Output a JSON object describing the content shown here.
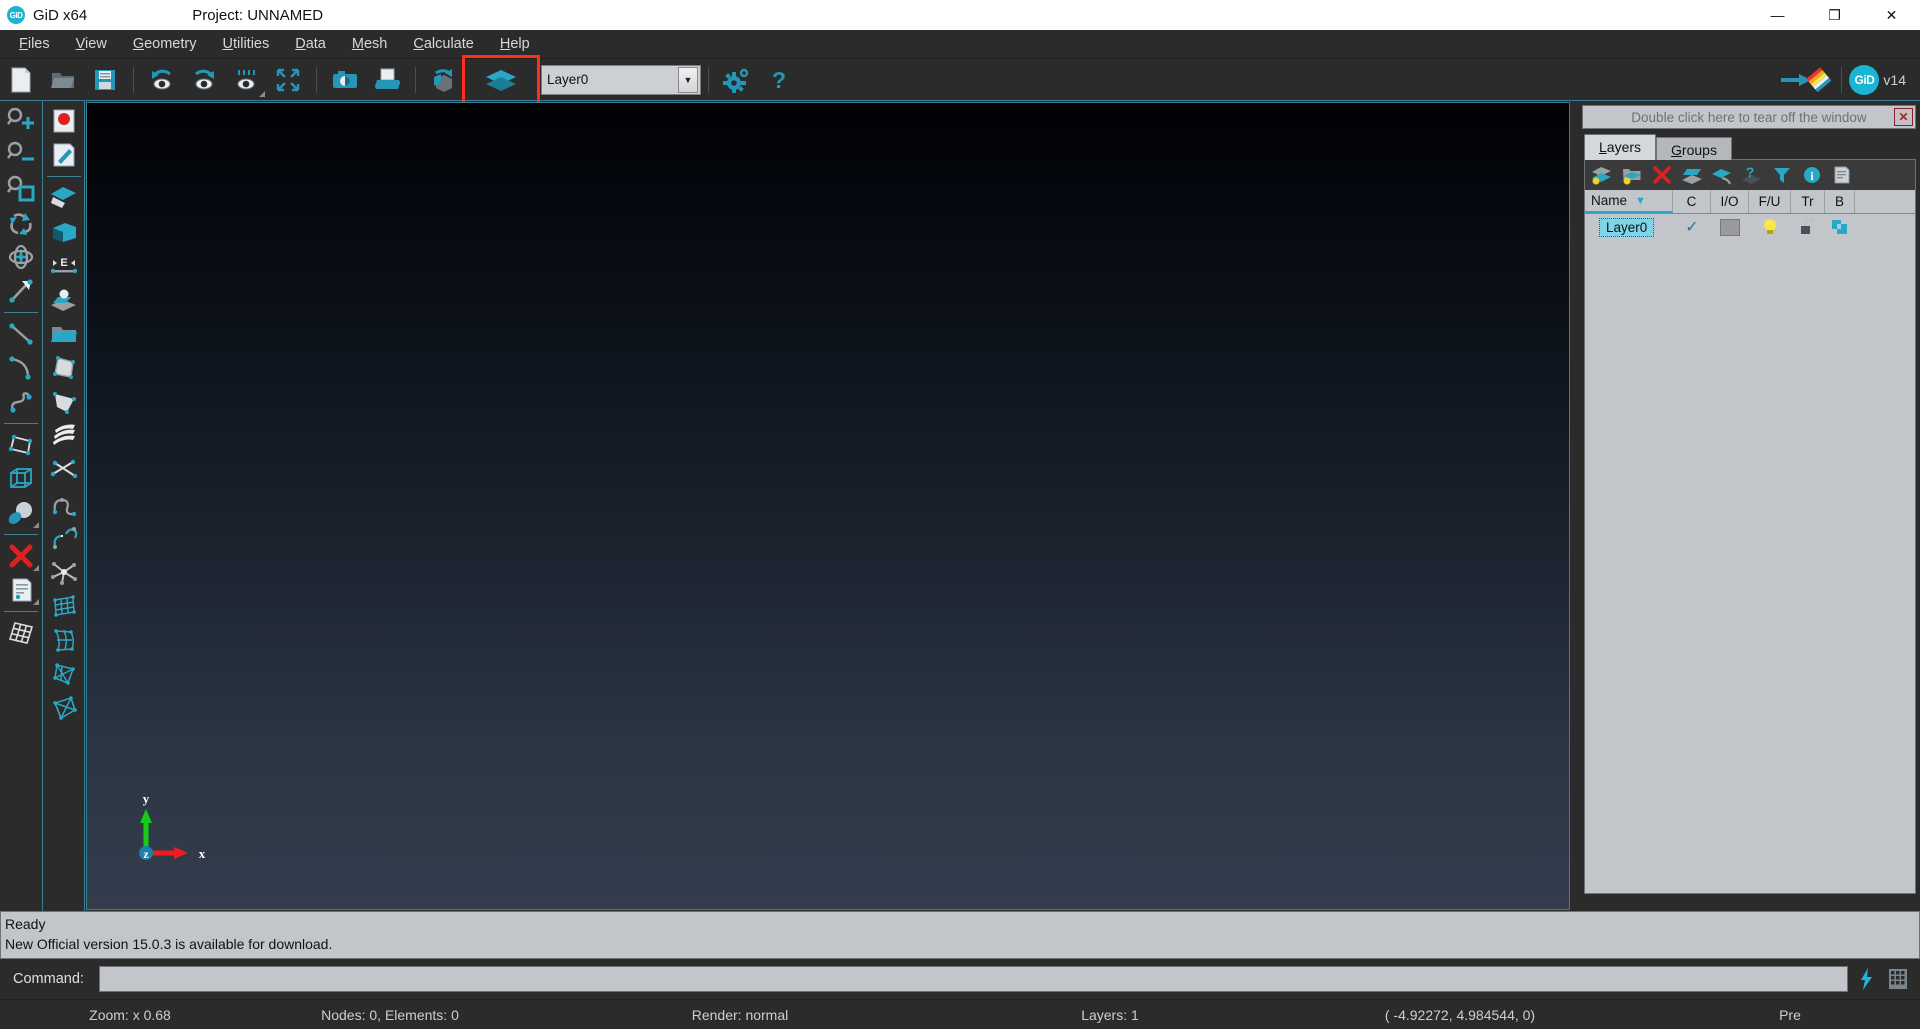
{
  "titlebar": {
    "logo_text": "GiD",
    "app_title": "GiD x64",
    "project_label": "Project: UNNAMED",
    "minimize_glyph": "—",
    "maximize_glyph": "❐",
    "close_glyph": "✕"
  },
  "menubar": {
    "items": [
      {
        "label": "Files",
        "accel": "F"
      },
      {
        "label": "View",
        "accel": "V"
      },
      {
        "label": "Geometry",
        "accel": "G"
      },
      {
        "label": "Utilities",
        "accel": "U"
      },
      {
        "label": "Data",
        "accel": "D"
      },
      {
        "label": "Mesh",
        "accel": "M"
      },
      {
        "label": "Calculate",
        "accel": "C"
      },
      {
        "label": "Help",
        "accel": "H"
      }
    ]
  },
  "toolbar": {
    "buttons": [
      {
        "name": "new-file-icon",
        "tip": "New"
      },
      {
        "name": "open-folder-icon",
        "tip": "Open"
      },
      {
        "name": "save-floppy-icon",
        "tip": "Save"
      },
      {
        "name": "undo-view-eye-icon",
        "tip": "Previous view"
      },
      {
        "name": "redo-view-eye-icon",
        "tip": "Next view"
      },
      {
        "name": "view-options-eye-icon",
        "tip": "View options"
      },
      {
        "name": "zoom-frame-icon",
        "tip": "Zoom frame"
      },
      {
        "name": "camera-icon",
        "tip": "Render image"
      },
      {
        "name": "print-icon",
        "tip": "Print"
      },
      {
        "name": "rotate-cube-icon",
        "tip": "Rotate"
      },
      {
        "name": "layers-icon",
        "tip": "Layers"
      }
    ],
    "layer_combo": {
      "value": "Layer0",
      "placeholder": "Layer0",
      "arrow_glyph": "▼"
    },
    "gear_icon": "preferences-gear-icon",
    "help_icon": "help-question-icon",
    "results_icon": "arrow-rainbow-icon",
    "gid_logo_text": "GiD",
    "version_label": "v14",
    "highlight_color": "#ff2d1a"
  },
  "left_toolbar": {
    "column_one": [
      {
        "name": "zoom-in-icon"
      },
      {
        "name": "zoom-out-icon"
      },
      {
        "name": "zoom-frame-icon"
      },
      {
        "name": "rotate-trackball-icon"
      },
      {
        "name": "pan-move-icon"
      },
      {
        "name": "normal-vector-icon"
      },
      {
        "separator": true
      },
      {
        "name": "create-line-icon"
      },
      {
        "name": "create-arc-icon"
      },
      {
        "name": "create-nurbs-line-icon"
      },
      {
        "separator": true
      },
      {
        "name": "create-surface-icon"
      },
      {
        "name": "create-volume-icon"
      },
      {
        "name": "create-object-icon"
      },
      {
        "separator": true
      },
      {
        "name": "delete-icon"
      },
      {
        "name": "list-entities-icon"
      },
      {
        "separator": true
      },
      {
        "name": "mesh-quadrilateral-icon"
      }
    ],
    "column_two": [
      {
        "name": "create-point-icon"
      },
      {
        "name": "edit-point-icon"
      },
      {
        "separator": true
      },
      {
        "name": "copy-layer-icon"
      },
      {
        "name": "volume-box-icon"
      },
      {
        "name": "edit-entity-icon"
      },
      {
        "name": "move-to-layer-icon"
      },
      {
        "name": "open-layer-folder-icon"
      },
      {
        "name": "nurbs-surface-icon"
      },
      {
        "name": "trimmed-surface-icon"
      },
      {
        "name": "mesh-layers-icon"
      },
      {
        "name": "intersect-lines-icon"
      },
      {
        "name": "join-lines-icon"
      },
      {
        "name": "split-line-icon"
      },
      {
        "name": "explode-icon"
      },
      {
        "name": "mesh-structured-icon"
      },
      {
        "name": "mesh-unstructured-icon"
      },
      {
        "name": "mesh-surface-icon"
      },
      {
        "name": "mesh-volume-icon"
      }
    ]
  },
  "viewport": {
    "axes": {
      "x_label": "x",
      "y_label": "y",
      "z_label": "z",
      "x_color": "#ee1d1d",
      "y_color": "#16cc16",
      "z_color": "#1f7fa8"
    }
  },
  "right_panel": {
    "tearoff_text": "Double click here to tear off the window",
    "tearoff_close_glyph": "✕",
    "tabs": [
      {
        "label": "Layers",
        "accel": "L",
        "active": true
      },
      {
        "label": "Groups",
        "accel": "G",
        "active": false
      }
    ],
    "panel_toolbar": [
      {
        "name": "new-layer-icon"
      },
      {
        "name": "new-layer-group-icon"
      },
      {
        "name": "delete-layer-icon"
      },
      {
        "name": "open-layer-icon"
      },
      {
        "name": "send-to-layer-icon"
      },
      {
        "name": "layer-help-icon"
      },
      {
        "name": "filter-layers-icon"
      },
      {
        "name": "layer-info-icon"
      },
      {
        "name": "layer-report-icon"
      }
    ],
    "columns": [
      {
        "key": "name",
        "label": "Name",
        "sort_glyph": "▼"
      },
      {
        "key": "c",
        "label": "C"
      },
      {
        "key": "io",
        "label": "I/O"
      },
      {
        "key": "fu",
        "label": "F/U"
      },
      {
        "key": "tr",
        "label": "Tr"
      },
      {
        "key": "b",
        "label": "B"
      }
    ],
    "rows": [
      {
        "name": "Layer0",
        "c_glyph": "✓",
        "color_swatch": "#9a9a9a",
        "io_icon": "lightbulb-on-icon",
        "fu_icon": "unlocked-padlock-icon",
        "tr_icon": "transparency-icon",
        "b_icon": ""
      }
    ]
  },
  "messages": {
    "line1": "Ready",
    "line2": "New Official version 15.0.3 is available for download."
  },
  "command": {
    "label": "Command:",
    "value": "",
    "placeholder": "",
    "lightning_icon": "quick-command-icon",
    "keypad_icon": "numeric-keypad-icon",
    "lightning_color": "#1fb6dd"
  },
  "statusbar": {
    "zoom": "Zoom: x 0.68",
    "counts": "Nodes: 0, Elements: 0",
    "render": "Render: normal",
    "layers": "Layers: 1",
    "coords": "( -4.92272, 4.984544, 0)",
    "mode": "Pre"
  }
}
